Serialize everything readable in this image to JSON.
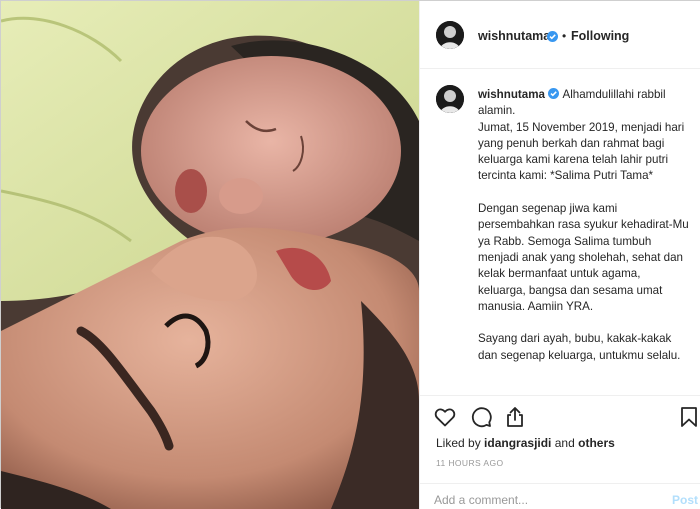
{
  "header": {
    "username": "wishnutama",
    "separator": "•",
    "follow_status": "Following"
  },
  "caption": {
    "username": "wishnutama",
    "first_line": "Alhamdulillahi rabbil alamin.",
    "paragraph1": "Jumat, 15 November 2019, menjadi hari yang penuh berkah dan rahmat bagi keluarga kami karena telah lahir putri tercinta kami: *Salima Putri Tama*",
    "paragraph2": "Dengan segenap jiwa kami persembahkan rasa syukur kehadirat-Mu ya Rabb. Semoga Salima tumbuh menjadi anak yang sholehah, sehat dan kelak bermanfaat untuk agama, keluarga, bangsa dan sesama umat manusia. Aamiin YRA.",
    "paragraph3": "Sayang dari ayah, bubu, kakak-kakak dan segenap keluarga, untukmu selalu."
  },
  "likes": {
    "prefix": "Liked by",
    "user": "idangrasjidi",
    "and": "and",
    "others": "others"
  },
  "timestamp": "11 HOURS AGO",
  "comment": {
    "placeholder": "Add a comment...",
    "post_label": "Post"
  },
  "icons": {
    "verified": "verified-badge-icon",
    "like": "heart-icon",
    "comment": "comment-bubble-icon",
    "share": "share-icon",
    "save": "bookmark-icon"
  },
  "colors": {
    "verified_blue": "#3897f0",
    "post_disabled": "#b2dffc",
    "muted_text": "#999999"
  }
}
